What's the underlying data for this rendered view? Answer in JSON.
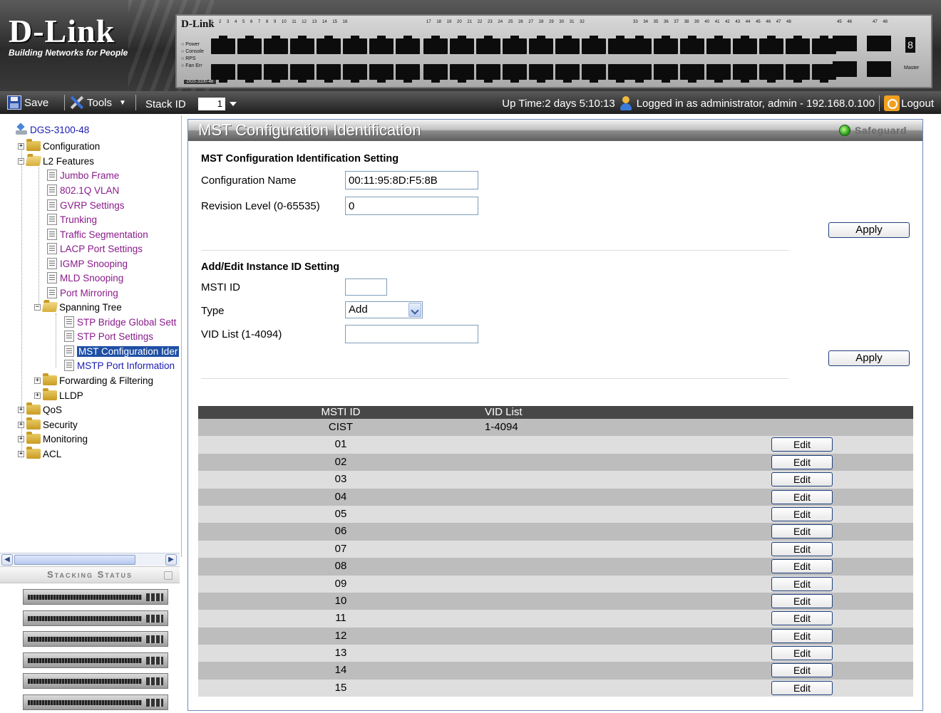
{
  "header": {
    "brand": "D-Link",
    "tagline": "Building Networks for People",
    "panel_brand": "D-Link",
    "panel_leds": [
      "Power",
      "Console",
      "RPS",
      "Fan Err"
    ],
    "panel_model": "DGS-3100-48",
    "port_numbers_1": "1 2 3 4 5 6 7 8 9 10 11 12 13 14 15 16",
    "port_numbers_2": "17 18 19 20 21 22 23 24 25 26 27 28 29 30 31 32",
    "port_numbers_3": "33 34 35 36 37 38 39 40 41 42 43 44 45 46 47 48",
    "combo_ports_a": "45 46",
    "combo_ports_b": "47 48",
    "unit_digit": "8",
    "master_label": "Master"
  },
  "toolbar": {
    "save_label": "Save",
    "tools_label": "Tools",
    "stack_id_label": "Stack ID",
    "stack_id_value": "1",
    "uptime": "Up Time:2 days 5:10:13",
    "login_status": "Logged in as administrator, admin - 192.168.0.100",
    "logout_label": "Logout"
  },
  "tree": {
    "root": "DGS-3100-48",
    "configuration": "Configuration",
    "l2_features": "L2 Features",
    "l2_items": [
      "Jumbo Frame",
      "802.1Q VLAN",
      "GVRP Settings",
      "Trunking",
      "Traffic Segmentation",
      "LACP Port Settings",
      "IGMP Snooping",
      "MLD Snooping",
      "Port Mirroring"
    ],
    "spanning_tree": "Spanning Tree",
    "stp_items": [
      "STP Bridge Global Sett",
      "STP Port Settings",
      "MST Configuration Ider",
      "MSTP Port Information"
    ],
    "forwarding": "Forwarding & Filtering",
    "lldp": "LLDP",
    "qos": "QoS",
    "security": "Security",
    "monitoring": "Monitoring",
    "acl": "ACL"
  },
  "stacking": {
    "title": "Stacking Status",
    "unit_count": 6
  },
  "main": {
    "title": "MST Configuration Identification",
    "safeguard": "Safeguard",
    "setting_title": "MST Configuration Identification Setting",
    "config_name_label": "Configuration Name",
    "config_name_value": "00:11:95:8D:F5:8B",
    "revision_label": "Revision Level (0-65535)",
    "revision_value": "0",
    "apply_label": "Apply",
    "instance_title": "Add/Edit Instance ID Setting",
    "msti_label": "MSTI ID",
    "msti_value": "",
    "type_label": "Type",
    "type_value": "Add",
    "vid_label": "VID List (1-4094)",
    "vid_value": "",
    "apply2_label": "Apply"
  },
  "table": {
    "headers": [
      "MSTI ID",
      "VID List"
    ],
    "edit_label": "Edit",
    "rows": [
      {
        "id": "CIST",
        "vid": "1-4094",
        "editable": false
      },
      {
        "id": "01",
        "vid": "",
        "editable": true
      },
      {
        "id": "02",
        "vid": "",
        "editable": true
      },
      {
        "id": "03",
        "vid": "",
        "editable": true
      },
      {
        "id": "04",
        "vid": "",
        "editable": true
      },
      {
        "id": "05",
        "vid": "",
        "editable": true
      },
      {
        "id": "06",
        "vid": "",
        "editable": true
      },
      {
        "id": "07",
        "vid": "",
        "editable": true
      },
      {
        "id": "08",
        "vid": "",
        "editable": true
      },
      {
        "id": "09",
        "vid": "",
        "editable": true
      },
      {
        "id": "10",
        "vid": "",
        "editable": true
      },
      {
        "id": "11",
        "vid": "",
        "editable": true
      },
      {
        "id": "12",
        "vid": "",
        "editable": true
      },
      {
        "id": "13",
        "vid": "",
        "editable": true
      },
      {
        "id": "14",
        "vid": "",
        "editable": true
      },
      {
        "id": "15",
        "vid": "",
        "editable": true
      }
    ]
  },
  "colors": {
    "accent": "#1f4fa5",
    "row_odd": "#bdbdbd",
    "row_even": "#dedede",
    "table_header": "#474747"
  }
}
